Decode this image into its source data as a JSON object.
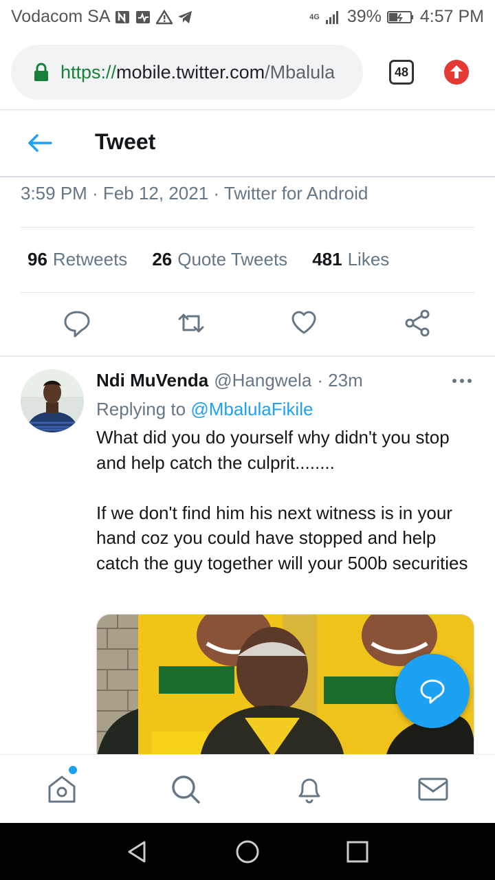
{
  "status_bar": {
    "carrier": "Vodacom SA",
    "network": "4G",
    "battery": "39%",
    "time": "4:57 PM"
  },
  "browser": {
    "url_scheme": "https://",
    "url_host": "mobile.twitter.com",
    "url_path": "/Mbalula",
    "tab_count": "48"
  },
  "header": {
    "title": "Tweet"
  },
  "tweet": {
    "meta_time": "3:59 PM · Feb 12, 2021",
    "meta_sep": " · ",
    "meta_source": "Twitter for Android",
    "retweets_count": "96",
    "retweets_label": "Retweets",
    "quotes_count": "26",
    "quotes_label": "Quote Tweets",
    "likes_count": "481",
    "likes_label": "Likes"
  },
  "reply": {
    "name": "Ndi MuVenda",
    "handle": "@Hangwela",
    "time": "· 23m",
    "replying_prefix": "Replying to ",
    "replying_mention": "@MbalulaFikile",
    "body": "What did you do yourself why didn't you stop and help catch the culprit........\n\nIf we don't find him his next witness is in your hand coz you could have stopped and help catch the guy together will your 500b securities"
  },
  "colors": {
    "accent": "#1da1f2",
    "text_secondary": "#657786",
    "lock_green": "#188038",
    "update_red": "#e53935"
  }
}
